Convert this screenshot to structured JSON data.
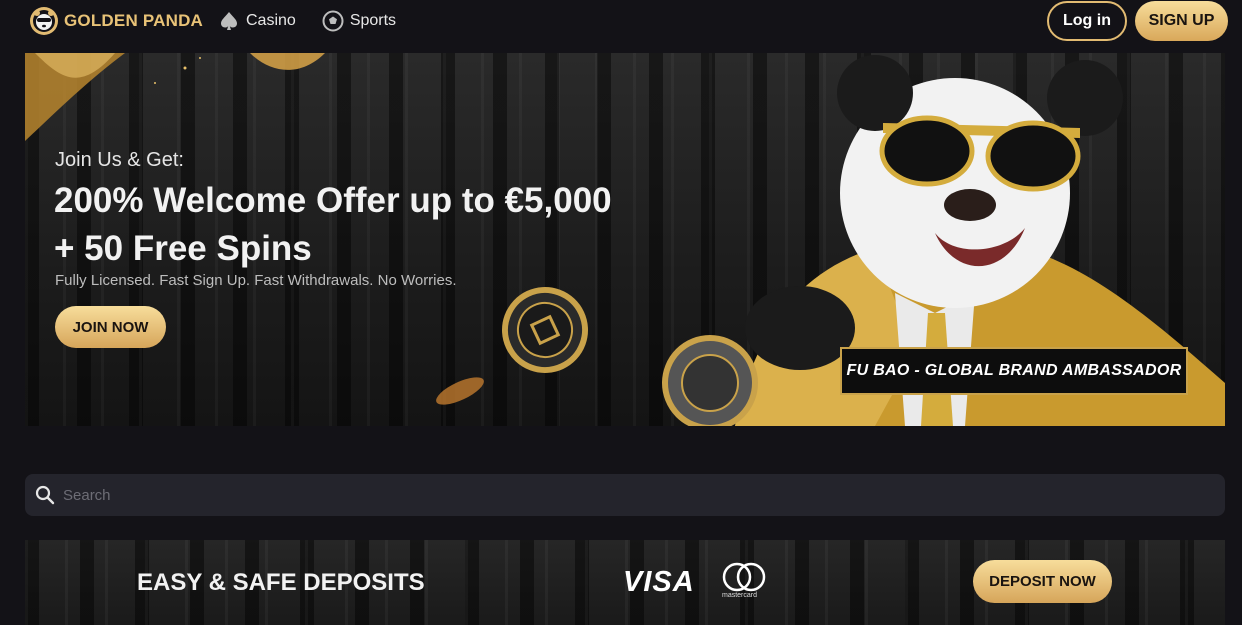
{
  "header": {
    "brand": "GOLDEN PANDA",
    "nav": [
      {
        "label": "Casino",
        "icon": "spade-icon"
      },
      {
        "label": "Sports",
        "icon": "soccer-ball-icon"
      }
    ],
    "login_label": "Log in",
    "signup_label": "SIGN UP"
  },
  "hero": {
    "subtitle": "Join Us & Get:",
    "title_line1": "200% Welcome Offer up to €5,000",
    "title_line2": "+ 50 Free Spins",
    "description": "Fully Licensed. Fast Sign Up. Fast Withdrawals. No Worries.",
    "cta_label": "JOIN NOW",
    "ambassador_label": "FU BAO - GLOBAL BRAND AMBASSADOR"
  },
  "search": {
    "placeholder": "Search",
    "value": ""
  },
  "deposit_banner": {
    "title": "EASY & SAFE DEPOSITS",
    "payment_methods": [
      "VISA",
      "mastercard"
    ],
    "cta_label": "DEPOSIT NOW"
  },
  "colors": {
    "background": "#131217",
    "accent_gold": "#e2bb72",
    "button_gradient_top": "#f7dd9b",
    "button_gradient_bottom": "#d6a55a",
    "search_bg": "#24242c"
  }
}
